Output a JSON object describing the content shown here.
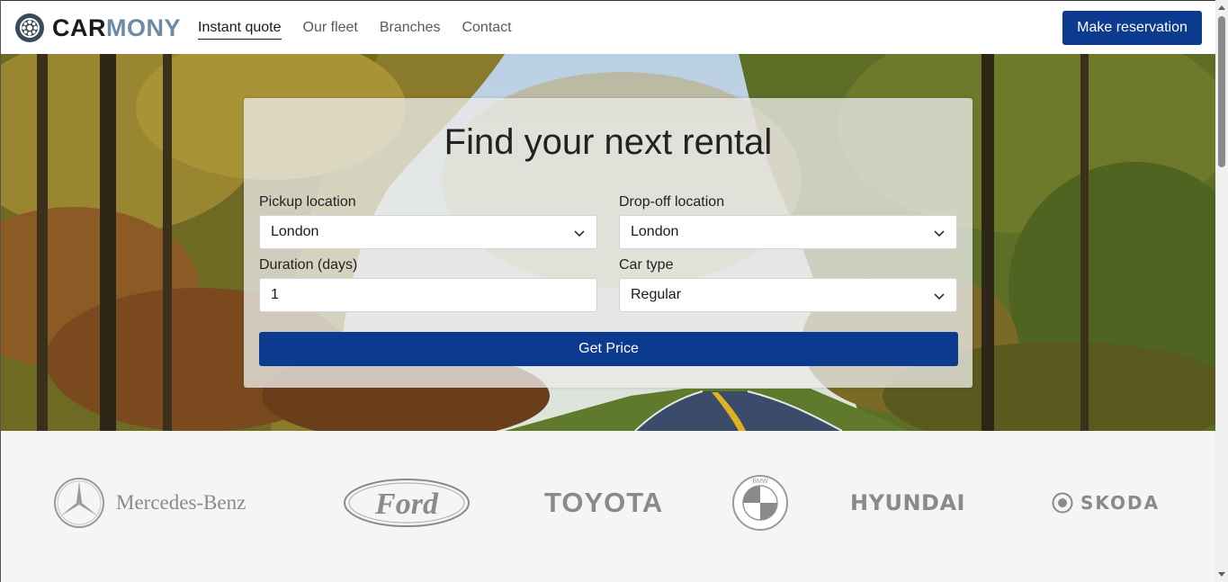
{
  "brand": {
    "name_part1": "CAR",
    "name_part2": "MONY"
  },
  "nav": {
    "items": [
      {
        "label": "Instant quote",
        "active": true
      },
      {
        "label": "Our fleet",
        "active": false
      },
      {
        "label": "Branches",
        "active": false
      },
      {
        "label": "Contact",
        "active": false
      }
    ],
    "cta_label": "Make reservation"
  },
  "form": {
    "title": "Find your next rental",
    "pickup": {
      "label": "Pickup location",
      "value": "London"
    },
    "dropoff": {
      "label": "Drop-off location",
      "value": "London"
    },
    "duration": {
      "label": "Duration (days)",
      "value": "1"
    },
    "car_type": {
      "label": "Car type",
      "value": "Regular"
    },
    "submit_label": "Get Price"
  },
  "brands": {
    "mercedes": "Mercedes-Benz",
    "ford": "Ford",
    "toyota": "TOYOTA",
    "bmw": "BMW",
    "hyundai": "HYUNDAI",
    "skoda": "SKODA"
  },
  "colors": {
    "primary": "#0b3a8f",
    "logo_accent": "#6b8aa5",
    "brand_grey": "#8a8a8a",
    "band_bg": "#f5f5f5"
  },
  "icons": {
    "logo": "wheel-icon",
    "select": "chevron-down-icon"
  }
}
